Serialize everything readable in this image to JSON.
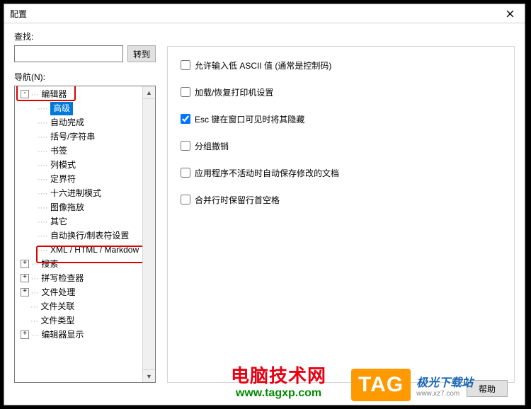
{
  "window": {
    "title": "配置"
  },
  "search": {
    "label": "查找:",
    "goto_label": "转到",
    "value": ""
  },
  "nav": {
    "label": "导航(N):"
  },
  "tree": {
    "editor": {
      "label": "编辑器",
      "expander": "-"
    },
    "children": [
      {
        "label": "高级",
        "selected": true
      },
      {
        "label": "自动完成"
      },
      {
        "label": "括号/字符串"
      },
      {
        "label": "书签"
      },
      {
        "label": "列模式"
      },
      {
        "label": "定界符"
      },
      {
        "label": "十六进制模式"
      },
      {
        "label": "图像拖放"
      },
      {
        "label": "其它"
      },
      {
        "label": "自动换行/制表符设置"
      },
      {
        "label": "XML / HTML / Markdow"
      }
    ],
    "siblings": [
      {
        "label": "搜索",
        "expander": "+"
      },
      {
        "label": "拼写检查器",
        "expander": "+"
      },
      {
        "label": "文件处理",
        "expander": "+"
      },
      {
        "label": "文件关联",
        "expander": ""
      },
      {
        "label": "文件类型",
        "expander": ""
      },
      {
        "label": "编辑器显示",
        "expander": "+"
      }
    ]
  },
  "options": [
    {
      "label": "允许输入低 ASCII 值 (通常是控制码)",
      "checked": false
    },
    {
      "label": "加载/恢复打印机设置",
      "checked": false
    },
    {
      "label": "Esc 键在窗口可见时将其隐藏",
      "checked": true
    },
    {
      "label": "分组撤销",
      "checked": false
    },
    {
      "label": "应用程序不活动时自动保存修改的文档",
      "checked": false
    },
    {
      "label": "合并行时保留行首空格",
      "checked": false
    }
  ],
  "buttons": {
    "help": "帮助"
  },
  "watermark": {
    "site1_line1": "电脑技术网",
    "site1_line2": "www.tagxp.com",
    "tag": "TAG",
    "site2_name": "极光下载站",
    "site2_url": "www.xz7.com"
  }
}
